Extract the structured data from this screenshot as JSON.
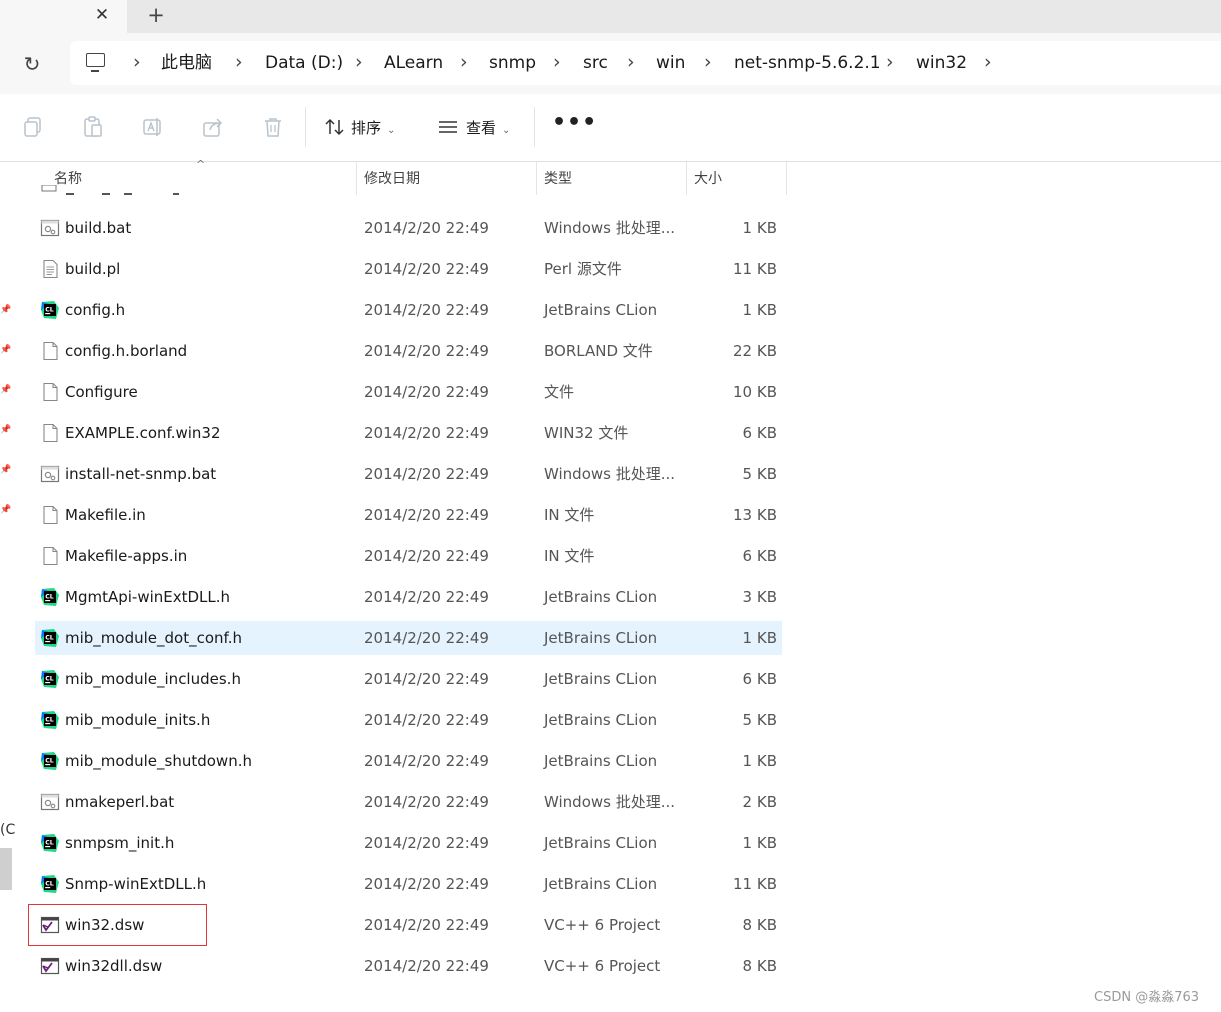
{
  "tabs": {
    "close_icon": "close-icon",
    "add_icon": "plus-icon"
  },
  "address": {
    "refresh_icon": "refresh-icon",
    "pc_icon": "computer-icon",
    "crumbs": [
      "此电脑",
      "Data (D:)",
      "ALearn",
      "snmp",
      "src",
      "win",
      "net-snmp-5.6.2.1",
      "win32"
    ]
  },
  "toolbar": {
    "buttons": [
      "copy-icon",
      "paste-icon",
      "rename-icon",
      "share-icon",
      "delete-icon"
    ],
    "sort_label": "排序",
    "view_label": "查看",
    "more_label": "•••"
  },
  "nav": {
    "partial_text": "(C"
  },
  "columns": {
    "name": "名称",
    "date": "修改日期",
    "type": "类型",
    "size": "大小"
  },
  "files": [
    {
      "name": "build.bat",
      "date": "2014/2/20 22:49",
      "type": "Windows 批处理...",
      "size": "1 KB",
      "icon": "batch-file-icon"
    },
    {
      "name": "build.pl",
      "date": "2014/2/20 22:49",
      "type": "Perl 源文件",
      "size": "11 KB",
      "icon": "text-file-icon"
    },
    {
      "name": "config.h",
      "date": "2014/2/20 22:49",
      "type": "JetBrains CLion",
      "size": "1 KB",
      "icon": "clion-icon"
    },
    {
      "name": "config.h.borland",
      "date": "2014/2/20 22:49",
      "type": "BORLAND 文件",
      "size": "22 KB",
      "icon": "blank-file-icon"
    },
    {
      "name": "Configure",
      "date": "2014/2/20 22:49",
      "type": "文件",
      "size": "10 KB",
      "icon": "blank-file-icon"
    },
    {
      "name": "EXAMPLE.conf.win32",
      "date": "2014/2/20 22:49",
      "type": "WIN32 文件",
      "size": "6 KB",
      "icon": "blank-file-icon"
    },
    {
      "name": "install-net-snmp.bat",
      "date": "2014/2/20 22:49",
      "type": "Windows 批处理...",
      "size": "5 KB",
      "icon": "batch-file-icon"
    },
    {
      "name": "Makefile.in",
      "date": "2014/2/20 22:49",
      "type": "IN 文件",
      "size": "13 KB",
      "icon": "blank-file-icon"
    },
    {
      "name": "Makefile-apps.in",
      "date": "2014/2/20 22:49",
      "type": "IN 文件",
      "size": "6 KB",
      "icon": "blank-file-icon"
    },
    {
      "name": "MgmtApi-winExtDLL.h",
      "date": "2014/2/20 22:49",
      "type": "JetBrains CLion",
      "size": "3 KB",
      "icon": "clion-icon"
    },
    {
      "name": "mib_module_dot_conf.h",
      "date": "2014/2/20 22:49",
      "type": "JetBrains CLion",
      "size": "1 KB",
      "icon": "clion-icon"
    },
    {
      "name": "mib_module_includes.h",
      "date": "2014/2/20 22:49",
      "type": "JetBrains CLion",
      "size": "6 KB",
      "icon": "clion-icon"
    },
    {
      "name": "mib_module_inits.h",
      "date": "2014/2/20 22:49",
      "type": "JetBrains CLion",
      "size": "5 KB",
      "icon": "clion-icon"
    },
    {
      "name": "mib_module_shutdown.h",
      "date": "2014/2/20 22:49",
      "type": "JetBrains CLion",
      "size": "1 KB",
      "icon": "clion-icon"
    },
    {
      "name": "nmakeperl.bat",
      "date": "2014/2/20 22:49",
      "type": "Windows 批处理...",
      "size": "2 KB",
      "icon": "batch-file-icon"
    },
    {
      "name": "snmpsm_init.h",
      "date": "2014/2/20 22:49",
      "type": "JetBrains CLion",
      "size": "1 KB",
      "icon": "clion-icon"
    },
    {
      "name": "Snmp-winExtDLL.h",
      "date": "2014/2/20 22:49",
      "type": "JetBrains CLion",
      "size": "11 KB",
      "icon": "clion-icon"
    },
    {
      "name": "win32.dsw",
      "date": "2014/2/20 22:49",
      "type": "VC++ 6 Project",
      "size": "8 KB",
      "icon": "vs-project-icon"
    },
    {
      "name": "win32dll.dsw",
      "date": "2014/2/20 22:49",
      "type": "VC++ 6 Project",
      "size": "8 KB",
      "icon": "vs-project-icon"
    }
  ],
  "selected_file": "mib_module_dot_conf.h",
  "highlighted_file": "win32.dsw",
  "colors": {
    "selection": "#e5f3ff",
    "highlight_border": "#e0353a",
    "clion_green": "#21d789"
  },
  "watermark": "CSDN @淼淼763"
}
